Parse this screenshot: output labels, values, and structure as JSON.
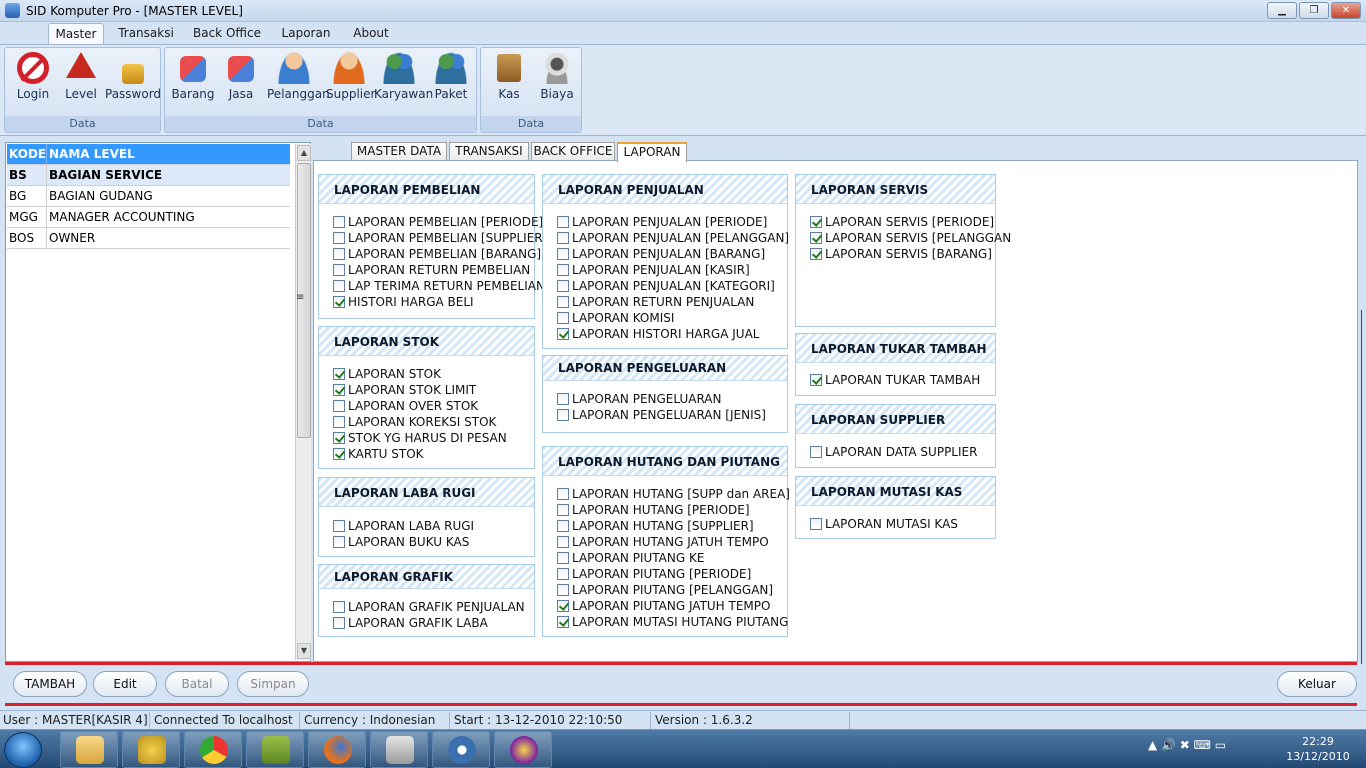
{
  "window": {
    "title": "SID Komputer Pro - [MASTER LEVEL]",
    "controls": {
      "minimize": "▁",
      "restore": "❐",
      "close": "✕"
    }
  },
  "menu": {
    "tabs": [
      {
        "label": "Master",
        "active": true
      },
      {
        "label": "Transaksi"
      },
      {
        "label": "Back Office"
      },
      {
        "label": "Laporan"
      },
      {
        "label": "About"
      }
    ]
  },
  "ribbon": {
    "groups": [
      {
        "label": "Data",
        "buttons": [
          {
            "label": "Login",
            "icon": "no-entry-icon"
          },
          {
            "label": "Level",
            "icon": "warning-icon"
          },
          {
            "label": "Password",
            "icon": "padlock-icon"
          }
        ]
      },
      {
        "label": "Data",
        "buttons": [
          {
            "label": "Barang",
            "icon": "cubes-icon"
          },
          {
            "label": "Jasa",
            "icon": "cubes-icon"
          },
          {
            "label": "Pelanggan",
            "icon": "customer-icon"
          },
          {
            "label": "Supplier",
            "icon": "supplier-icon"
          },
          {
            "label": "Karyawan",
            "icon": "employees-icon"
          },
          {
            "label": "Paket",
            "icon": "package-people-icon"
          }
        ]
      },
      {
        "label": "Data",
        "buttons": [
          {
            "label": "Kas",
            "icon": "cashbook-icon"
          },
          {
            "label": "Biaya",
            "icon": "webcam-icon"
          }
        ]
      }
    ]
  },
  "level_table": {
    "headers": [
      "KODE",
      "NAMA LEVEL"
    ],
    "rows": [
      {
        "kode": "BS",
        "nama": "BAGIAN SERVICE",
        "selected": true
      },
      {
        "kode": "BG",
        "nama": "BAGIAN GUDANG"
      },
      {
        "kode": "MGG",
        "nama": "MANAGER ACCOUNTING"
      },
      {
        "kode": "BOS",
        "nama": "OWNER"
      }
    ],
    "scroll": {
      "up": "▲",
      "down": "▼",
      "splitter": "≡"
    }
  },
  "tabs": [
    {
      "label": "MASTER DATA"
    },
    {
      "label": "TRANSAKSI"
    },
    {
      "label": "BACK OFFICE"
    },
    {
      "label": "LAPORAN",
      "active": true
    }
  ],
  "sections": {
    "pembelian": {
      "title": "LAPORAN PEMBELIAN",
      "items": [
        {
          "label": "LAPORAN PEMBELIAN [PERIODE]",
          "checked": false
        },
        {
          "label": "LAPORAN PEMBELIAN [SUPPLIER]",
          "checked": false
        },
        {
          "label": "LAPORAN PEMBELIAN [BARANG]",
          "checked": false
        },
        {
          "label": "LAPORAN RETURN PEMBELIAN",
          "checked": false
        },
        {
          "label": "LAP TERIMA RETURN PEMBELIAN",
          "checked": false
        },
        {
          "label": "HISTORI HARGA BELI",
          "checked": true
        }
      ]
    },
    "stok": {
      "title": "LAPORAN STOK",
      "items": [
        {
          "label": "LAPORAN STOK",
          "checked": true
        },
        {
          "label": "LAPORAN STOK LIMIT",
          "checked": true
        },
        {
          "label": "LAPORAN OVER STOK",
          "checked": false
        },
        {
          "label": "LAPORAN KOREKSI STOK",
          "checked": false
        },
        {
          "label": "STOK YG HARUS DI PESAN",
          "checked": true
        },
        {
          "label": "KARTU STOK",
          "checked": true
        }
      ]
    },
    "labarugi": {
      "title": "LAPORAN LABA RUGI",
      "items": [
        {
          "label": "LAPORAN LABA RUGI",
          "checked": false
        },
        {
          "label": "LAPORAN BUKU KAS",
          "checked": false
        }
      ]
    },
    "grafik": {
      "title": "LAPORAN GRAFIK",
      "items": [
        {
          "label": "LAPORAN GRAFIK PENJUALAN",
          "checked": false
        },
        {
          "label": "LAPORAN GRAFIK LABA",
          "checked": false
        }
      ]
    },
    "penjualan": {
      "title": "LAPORAN PENJUALAN",
      "items": [
        {
          "label": "LAPORAN PENJUALAN [PERIODE]",
          "checked": false
        },
        {
          "label": "LAPORAN PENJUALAN [PELANGGAN]",
          "checked": false
        },
        {
          "label": "LAPORAN PENJUALAN [BARANG]",
          "checked": false
        },
        {
          "label": "LAPORAN PENJUALAN [KASIR]",
          "checked": false
        },
        {
          "label": "LAPORAN PENJUALAN [KATEGORI]",
          "checked": false
        },
        {
          "label": "LAPORAN RETURN PENJUALAN",
          "checked": false
        },
        {
          "label": "LAPORAN KOMISI",
          "checked": false
        },
        {
          "label": "LAPORAN HISTORI HARGA JUAL",
          "checked": true
        }
      ]
    },
    "pengeluaran": {
      "title": "LAPORAN PENGELUARAN",
      "items": [
        {
          "label": "LAPORAN PENGELUARAN",
          "checked": false
        },
        {
          "label": "LAPORAN PENGELUARAN [JENIS]",
          "checked": false
        }
      ]
    },
    "hutang": {
      "title": "LAPORAN HUTANG DAN PIUTANG",
      "items": [
        {
          "label": "LAPORAN HUTANG [SUPP dan AREA]",
          "checked": false
        },
        {
          "label": "LAPORAN HUTANG [PERIODE]",
          "checked": false
        },
        {
          "label": "LAPORAN HUTANG [SUPPLIER]",
          "checked": false
        },
        {
          "label": "LAPORAN HUTANG JATUH TEMPO",
          "checked": false
        },
        {
          "label": "LAPORAN PIUTANG KE",
          "checked": false
        },
        {
          "label": "LAPORAN PIUTANG [PERIODE]",
          "checked": false
        },
        {
          "label": "LAPORAN PIUTANG [PELANGGAN]",
          "checked": false
        },
        {
          "label": "LAPORAN PIUTANG JATUH TEMPO",
          "checked": true
        },
        {
          "label": "LAPORAN MUTASI HUTANG PIUTANG",
          "checked": true
        }
      ]
    },
    "servis": {
      "title": "LAPORAN SERVIS",
      "items": [
        {
          "label": "LAPORAN SERVIS [PERIODE]",
          "checked": true
        },
        {
          "label": "LAPORAN SERVIS [PELANGGAN",
          "checked": true
        },
        {
          "label": "LAPORAN SERVIS [BARANG]",
          "checked": true
        }
      ]
    },
    "tukar": {
      "title": "LAPORAN TUKAR TAMBAH",
      "items": [
        {
          "label": "LAPORAN TUKAR TAMBAH",
          "checked": true
        }
      ]
    },
    "supplier": {
      "title": "LAPORAN SUPPLIER",
      "items": [
        {
          "label": "LAPORAN DATA SUPPLIER",
          "checked": false
        }
      ]
    },
    "mutasikas": {
      "title": "LAPORAN MUTASI KAS",
      "items": [
        {
          "label": "LAPORAN MUTASI KAS",
          "checked": false
        }
      ]
    }
  },
  "actions": {
    "tambah": "TAMBAH",
    "edit": "Edit",
    "batal": "Batal",
    "simpan": "Simpan",
    "keluar": "Keluar"
  },
  "status": {
    "user": "User : MASTER[KASIR 4]",
    "connection": "Connected To localhost",
    "currency": "Currency : Indonesian",
    "start": "Start  : 13-12-2010 22:10:50",
    "version": "Version : 1.6.3.2"
  },
  "taskbar": {
    "apps": [
      "explorer-icon",
      "seven-icon",
      "chrome-icon",
      "hs-icon",
      "firefox-icon",
      "monitor-icon",
      "media-icon",
      "yahoo-icon"
    ],
    "tray_icons": "▲  🔊  ✖  ⌨  ▭",
    "time": "22:29",
    "date": "13/12/2010"
  },
  "colors": {
    "accent": "#3399ff",
    "red_divider": "#d8222b",
    "tab_active_border": "#f0a030"
  }
}
